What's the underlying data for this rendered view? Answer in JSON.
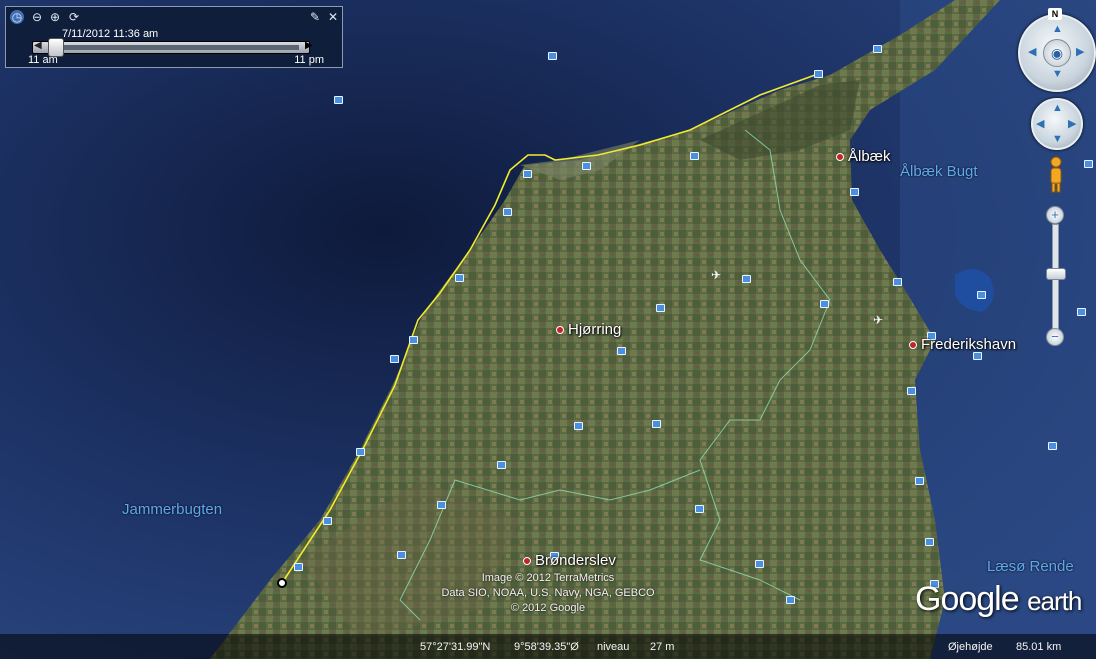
{
  "timeslider": {
    "date_label": "7/11/2012  11:36 am",
    "range_start": "11 am",
    "range_end": "11 pm",
    "icons": [
      "clock-icon",
      "zoom-out-icon",
      "zoom-in-icon",
      "refresh-icon",
      "wrench-icon",
      "close-icon"
    ]
  },
  "places": {
    "alback": "Ålbæk",
    "hjorring": "Hjørring",
    "frederikshavn": "Frederikshavn",
    "bronderslev": "Brønderslev"
  },
  "water": {
    "alback_bugt": "Ålbæk Bugt",
    "jammerbugten": "Jammerbugten",
    "laeso_rende": "Læsø Rende"
  },
  "attribution": {
    "line1": "Image © 2012 TerraMetrics",
    "line2": "Data SIO, NOAA, U.S. Navy, NGA, GEBCO",
    "line3": "© 2012 Google"
  },
  "logo": {
    "google": "Google",
    "earth": "earth"
  },
  "status": {
    "lat": "57°27'31.99\"N",
    "lon": "9°58'39.35\"Ø",
    "elev_label": "niveau",
    "elev_value": "27 m",
    "eye_label": "Øjehøjde",
    "eye_value": "85.01 km"
  },
  "nav": {
    "north_label": "N",
    "zoom_in": "+",
    "zoom_out": "−"
  },
  "colors": {
    "track": "#f2ea2e",
    "sea": "#1b2f5e",
    "land": "#5b6a44",
    "border_line": "#8fe0b0"
  }
}
